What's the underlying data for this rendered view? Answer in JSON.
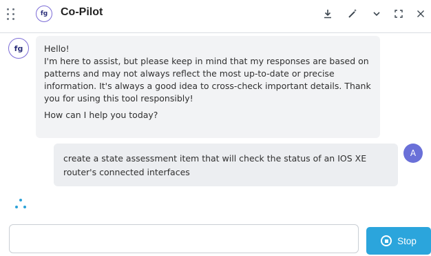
{
  "header": {
    "logo_text": "fg",
    "title": "Co-Pilot",
    "icons": [
      "download-icon",
      "magic-wand-icon",
      "chevron-down-icon",
      "expand-icon",
      "close-icon"
    ]
  },
  "messages": {
    "bot_avatar": "fg",
    "bot": {
      "greeting": "Hello!",
      "body": "I'm here to assist, but please keep in mind that my responses are based on patterns and may not always reflect the most up-to-date or precise information. It's always a good idea to cross-check important details. Thank you for using this tool responsibly!",
      "question": "How can I help you today?"
    },
    "user": {
      "avatar": "A",
      "text": "create a state assessment item that will check the status of an IOS XE router's connected interfaces"
    }
  },
  "composer": {
    "value": "",
    "stop_label": "Stop"
  },
  "colors": {
    "accent": "#2ba5dc",
    "user_avatar": "#6a70d8",
    "bubble_bg": "#f2f3f5"
  }
}
